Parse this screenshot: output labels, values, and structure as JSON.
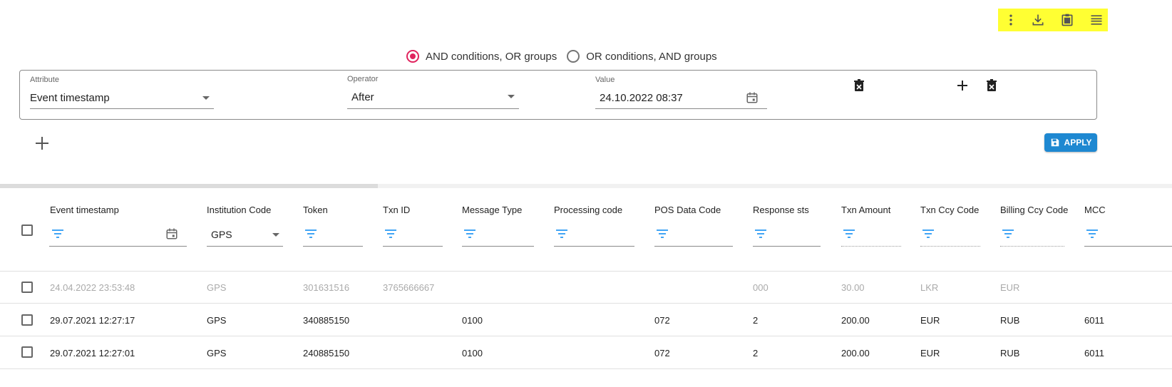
{
  "toolbar": {
    "icons": [
      "more-vert-icon",
      "download-icon",
      "clipboard-icon",
      "menu-lines-icon"
    ],
    "highlight_color": "#ffff33"
  },
  "logic": {
    "option_and": "AND conditions, OR groups",
    "option_or": "OR conditions, AND groups",
    "selected": "AND conditions, OR groups"
  },
  "condition": {
    "attribute_label": "Attribute",
    "attribute_value": "Event timestamp",
    "operator_label": "Operator",
    "operator_value": "After",
    "value_label": "Value",
    "value_value": "24.10.2022 08:37"
  },
  "apply_label": "APPLY",
  "accent_color": "#1e88d1",
  "radio_color": "#e0245e",
  "table": {
    "columns": [
      "Event timestamp",
      "Institution Code",
      "Token",
      "Txn ID",
      "Message Type",
      "Processing code",
      "POS Data Code",
      "Response sts",
      "Txn Amount",
      "Txn Ccy Code",
      "Billing Ccy Code",
      "MCC"
    ],
    "institution_filter": "GPS",
    "rows": [
      {
        "event_timestamp": "24.04.2022 23:53:48",
        "institution_code": "GPS",
        "token": "301631516",
        "txn_id": "3765666667",
        "message_type": "",
        "processing_code": "",
        "pos_data_code": "",
        "response_sts": "000",
        "txn_amount": "30.00",
        "txn_ccy_code": "LKR",
        "billing_ccy_code": "EUR",
        "mcc": ""
      },
      {
        "event_timestamp": "29.07.2021 12:27:17",
        "institution_code": "GPS",
        "token": "340885150",
        "txn_id": "",
        "message_type": "0100",
        "processing_code": "",
        "pos_data_code": "072",
        "response_sts": "2",
        "txn_amount": "200.00",
        "txn_ccy_code": "EUR",
        "billing_ccy_code": "RUB",
        "mcc": "6011"
      },
      {
        "event_timestamp": "29.07.2021 12:27:01",
        "institution_code": "GPS",
        "token": "240885150",
        "txn_id": "",
        "message_type": "0100",
        "processing_code": "",
        "pos_data_code": "072",
        "response_sts": "2",
        "txn_amount": "200.00",
        "txn_ccy_code": "EUR",
        "billing_ccy_code": "RUB",
        "mcc": "6011"
      }
    ]
  }
}
